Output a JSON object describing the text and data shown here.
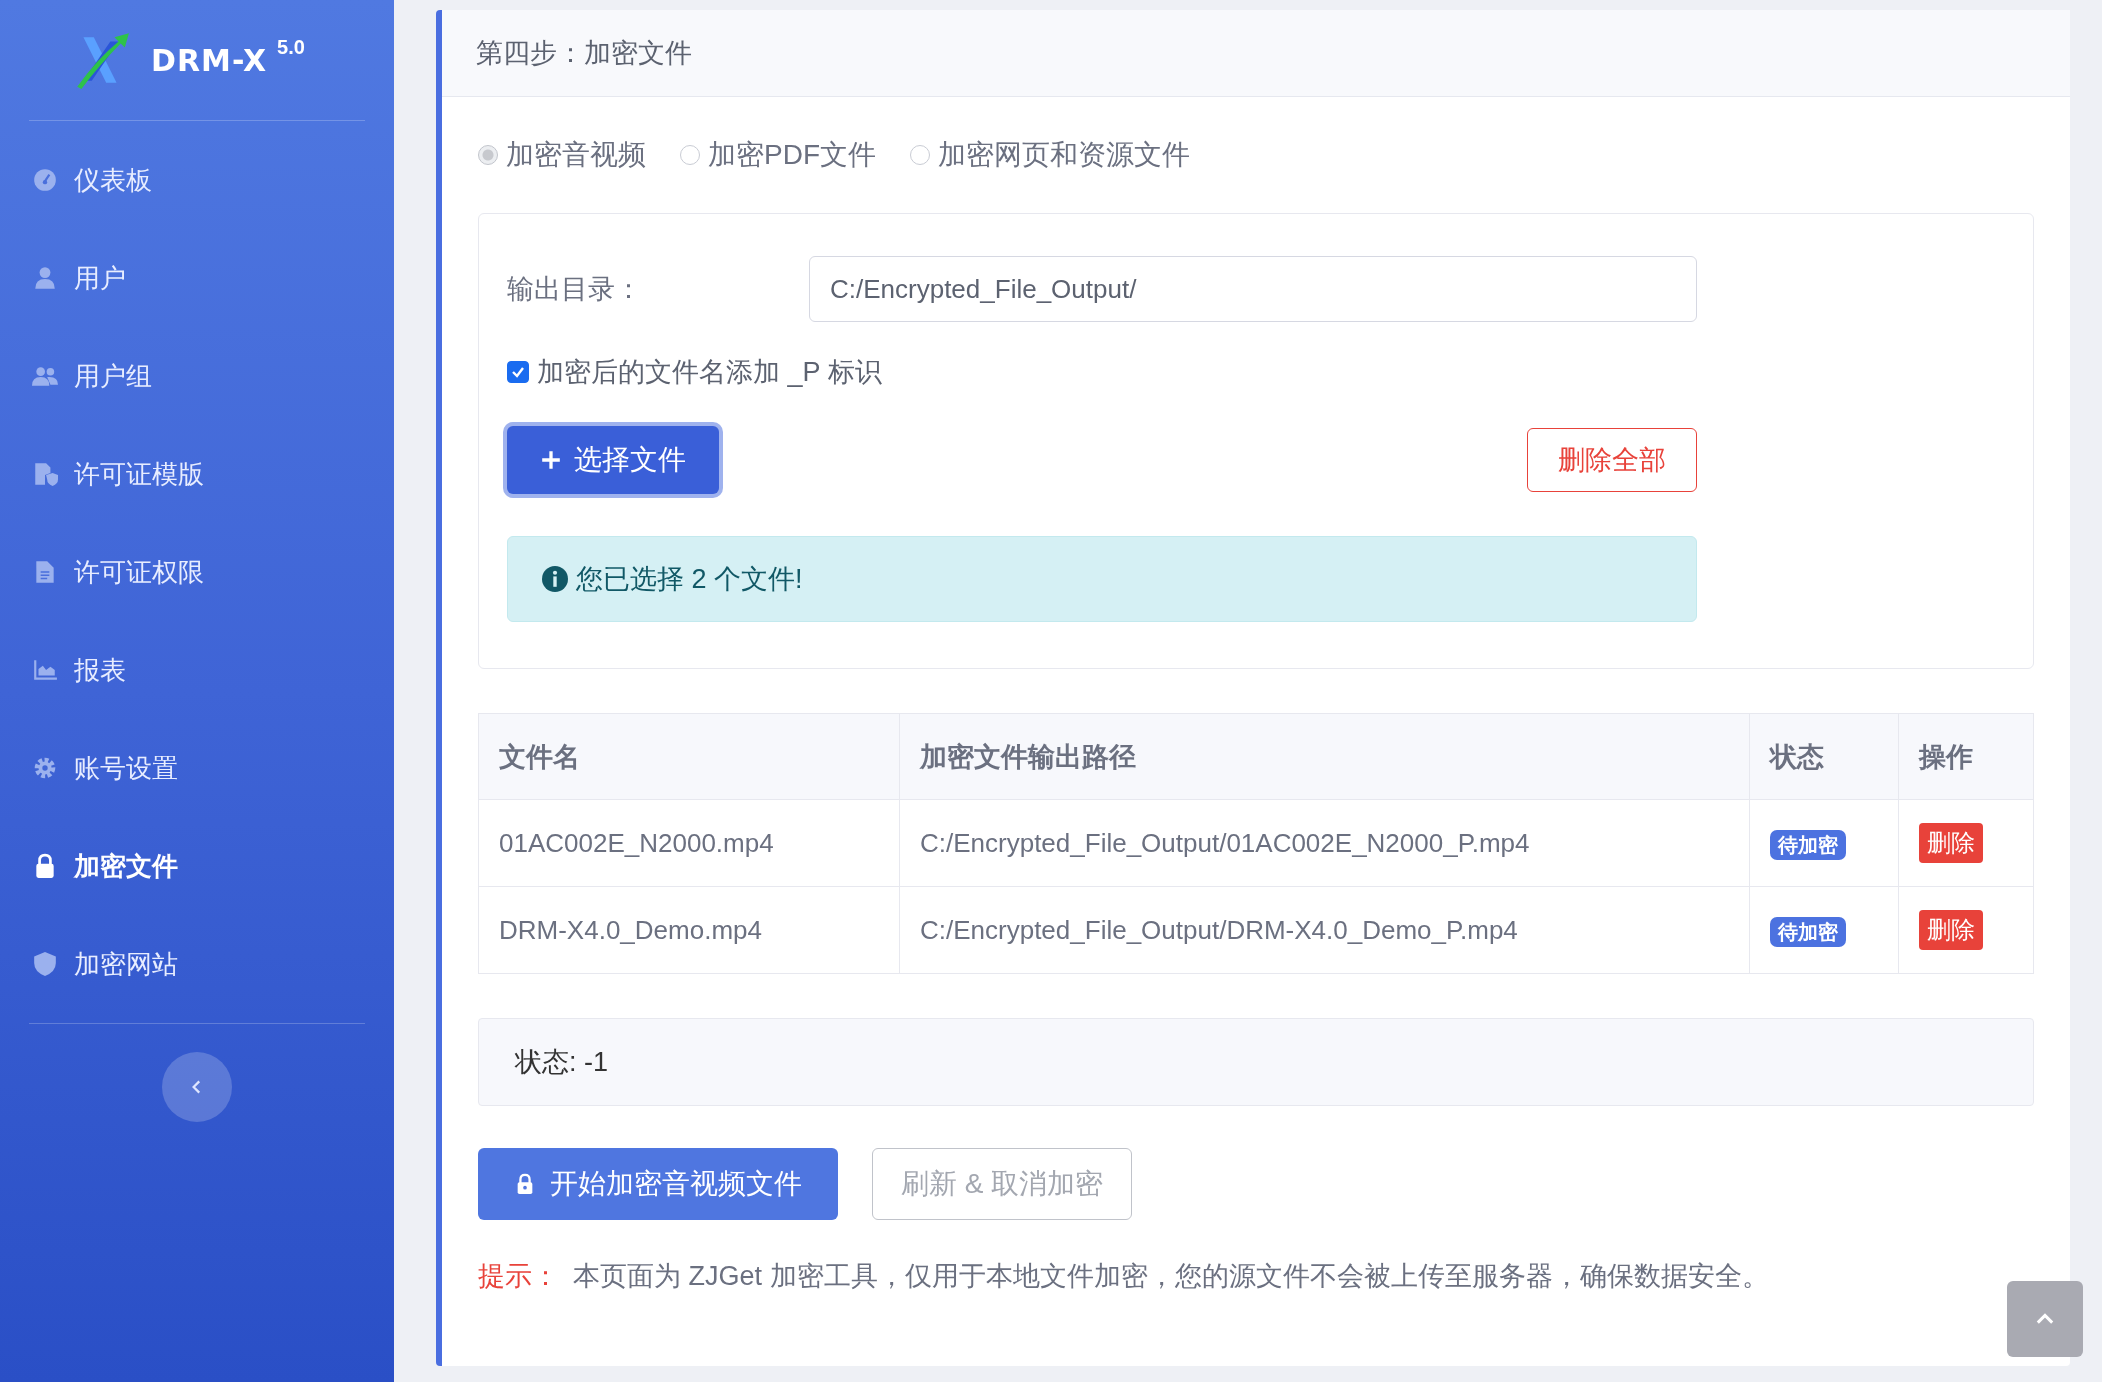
{
  "sidebar": {
    "logo": {
      "name": "DRM-X",
      "version": "5.0"
    },
    "items": [
      {
        "label": "仪表板",
        "selected": false
      },
      {
        "label": "用户",
        "selected": false
      },
      {
        "label": "用户组",
        "selected": false
      },
      {
        "label": "许可证模版",
        "selected": false
      },
      {
        "label": "许可证权限",
        "selected": false
      },
      {
        "label": "报表",
        "selected": false
      },
      {
        "label": "账号设置",
        "selected": false
      },
      {
        "label": "加密文件",
        "selected": true
      },
      {
        "label": "加密网站",
        "selected": false
      }
    ]
  },
  "card": {
    "title": "第四步：加密文件",
    "file_types": [
      {
        "label": "加密音视频",
        "selected": true
      },
      {
        "label": "加密PDF文件",
        "selected": false
      },
      {
        "label": "加密网页和资源文件",
        "selected": false
      }
    ],
    "output_dir": {
      "label": "输出目录：",
      "value": "C:/Encrypted_File_Output/"
    },
    "suffix_option": {
      "label": "加密后的文件名添加 _P 标识",
      "checked": true
    },
    "choose_button": "选择文件",
    "delete_all_button": "删除全部",
    "alert": "您已选择 2 个文件!",
    "table": {
      "columns": [
        "文件名",
        "加密文件输出路径",
        "状态",
        "操作"
      ],
      "rows": [
        {
          "file": "01AC002E_N2000.mp4",
          "path": "C:/Encrypted_File_Output/01AC002E_N2000_P.mp4",
          "status": "待加密",
          "action": "删除"
        },
        {
          "file": "DRM-X4.0_Demo.mp4",
          "path": "C:/Encrypted_File_Output/DRM-X4.0_Demo_P.mp4",
          "status": "待加密",
          "action": "删除"
        }
      ]
    },
    "status_text": "状态: -1",
    "start_button": "开始加密音视频文件",
    "refresh_button": "刷新 & 取消加密",
    "hint": {
      "label": "提示：",
      "text": "本页面为 ZJGet 加密工具，仅用于本地文件加密，您的源文件不会被上传至服务器，确保数据安全。"
    }
  }
}
